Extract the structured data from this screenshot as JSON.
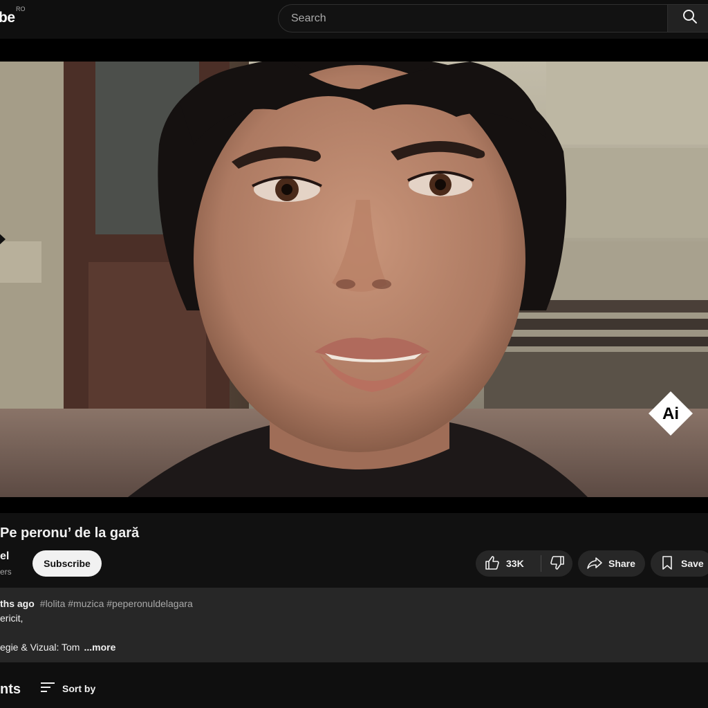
{
  "header": {
    "logo_text": "be",
    "country_code": "RO",
    "search_placeholder": "Search"
  },
  "video": {
    "title": "Pe peronu’ de la gară",
    "ai_badge": "Ai"
  },
  "channel": {
    "name": "el",
    "subscribers": "ers",
    "subscribe_label": "Subscribe"
  },
  "actions": {
    "like_count": "33K",
    "share_label": "Share",
    "save_label": "Save"
  },
  "description": {
    "age": "ths ago",
    "hashtags": "#lolita #muzica #peperonuldelagara",
    "line1": "ericit,",
    "line2": "egie & Vizual: Tom",
    "more_label": "...more"
  },
  "comments": {
    "label": "nts",
    "sort_label": "Sort by"
  },
  "colors": {
    "background": "#0f0f0f",
    "pill_background": "#272727",
    "description_background": "#272727",
    "subscribe_background": "#f1f1f1",
    "secondary_text": "#aaaaaa"
  }
}
